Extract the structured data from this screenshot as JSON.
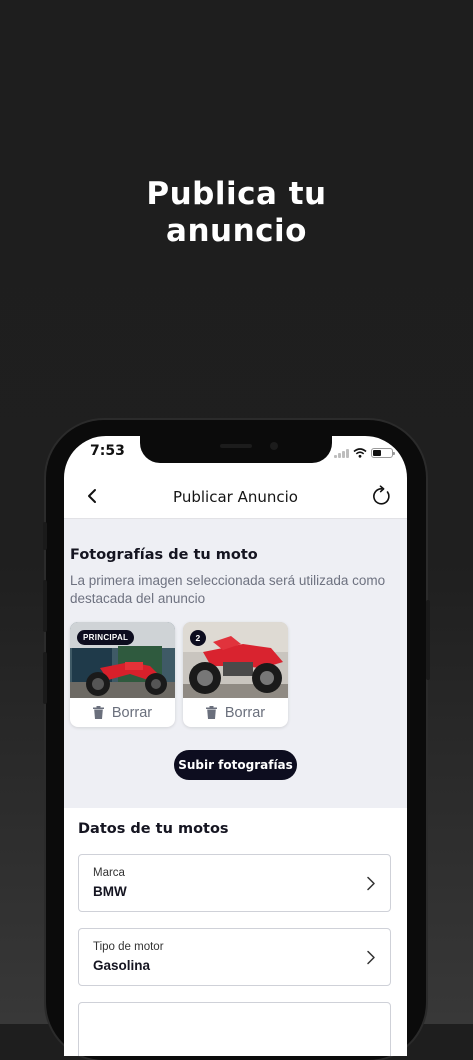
{
  "hero": {
    "line1": "Publica tu",
    "line2": "anuncio"
  },
  "status_bar": {
    "time": "7:53"
  },
  "navbar": {
    "title": "Publicar Anuncio",
    "back_icon": "chevron-left-icon",
    "refresh_icon": "refresh-icon"
  },
  "photos": {
    "title": "Fotografías de tu moto",
    "description": "La primera imagen seleccionada será utilizada como destacada del anuncio",
    "items": [
      {
        "badge": "PRINCIPAL",
        "delete_label": "Borrar"
      },
      {
        "badge": "2",
        "delete_label": "Borrar"
      }
    ],
    "upload_label": "Subir fotografías"
  },
  "details": {
    "title": "Datos de tu motos",
    "fields": [
      {
        "label": "Marca",
        "value": "BMW"
      },
      {
        "label": "Tipo de motor",
        "value": "Gasolina"
      }
    ]
  },
  "colors": {
    "accent": "#0d0d1f",
    "section_bg": "#eeeff4",
    "page_bg": "#1e1e1e"
  }
}
